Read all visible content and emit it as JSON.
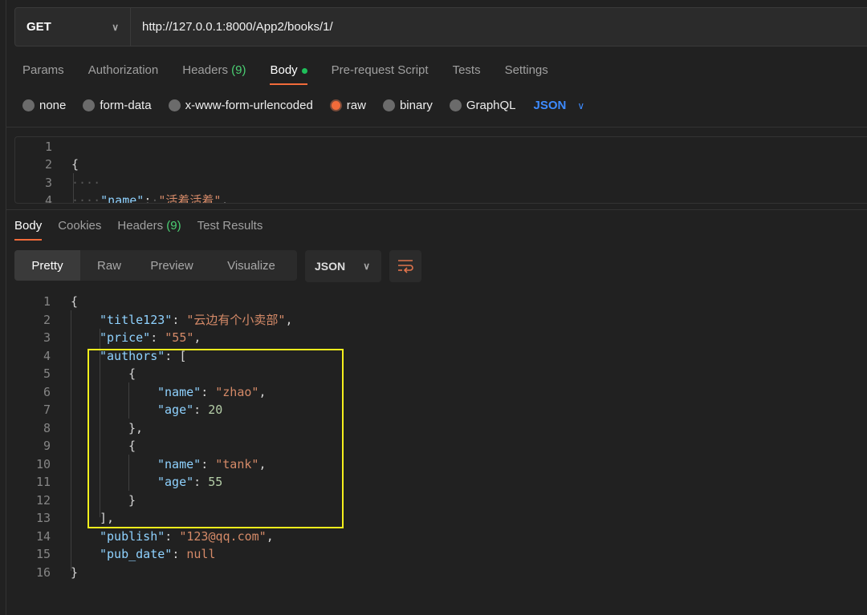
{
  "request": {
    "method": "GET",
    "url": "http://127.0.0.1:8000/App2/books/1/"
  },
  "request_tabs": [
    {
      "label": "Params"
    },
    {
      "label": "Authorization"
    },
    {
      "label": "Headers",
      "count": "(9)"
    },
    {
      "label": "Body",
      "active": true
    },
    {
      "label": "Pre-request Script"
    },
    {
      "label": "Tests"
    },
    {
      "label": "Settings"
    }
  ],
  "body_types": [
    {
      "label": "none"
    },
    {
      "label": "form-data"
    },
    {
      "label": "x-www-form-urlencoded"
    },
    {
      "label": "raw",
      "selected": true
    },
    {
      "label": "binary"
    },
    {
      "label": "GraphQL"
    }
  ],
  "body_format": "JSON",
  "request_body": [
    {
      "num": "1",
      "tokens": []
    },
    {
      "num": "2",
      "tokens": [
        {
          "c": "p",
          "t": "{"
        }
      ]
    },
    {
      "num": "3",
      "tokens": [
        {
          "c": "ws",
          "t": "····"
        }
      ]
    },
    {
      "num": "4",
      "tokens": [
        {
          "c": "ws",
          "t": "····"
        },
        {
          "c": "k",
          "t": "\"name\""
        },
        {
          "c": "p",
          "t": ":"
        },
        {
          "c": "ws",
          "t": "·"
        },
        {
          "c": "s",
          "t": "\"活着活着\""
        },
        {
          "c": "p",
          "t": ","
        }
      ]
    }
  ],
  "response_tabs": [
    {
      "label": "Body",
      "active": true
    },
    {
      "label": "Cookies"
    },
    {
      "label": "Headers",
      "count": "(9)"
    },
    {
      "label": "Test Results"
    }
  ],
  "view_modes": [
    "Pretty",
    "Raw",
    "Preview",
    "Visualize"
  ],
  "response_format": "JSON",
  "colors": {
    "accent": "#f26b3a",
    "json_key": "#8fd2ff",
    "json_string": "#d58a68",
    "json_number": "#b5cea8",
    "highlight_box": "#f5f01c"
  },
  "response_body": [
    {
      "num": "1",
      "indent": 0,
      "tokens": [
        {
          "c": "p",
          "t": "{"
        }
      ]
    },
    {
      "num": "2",
      "indent": 1,
      "tokens": [
        {
          "c": "k",
          "t": "\"title123\""
        },
        {
          "c": "p",
          "t": ": "
        },
        {
          "c": "s",
          "t": "\"云边有个小卖部\""
        },
        {
          "c": "p",
          "t": ","
        }
      ]
    },
    {
      "num": "3",
      "indent": 1,
      "tokens": [
        {
          "c": "k",
          "t": "\"price\""
        },
        {
          "c": "p",
          "t": ": "
        },
        {
          "c": "s",
          "t": "\"55\""
        },
        {
          "c": "p",
          "t": ","
        }
      ]
    },
    {
      "num": "4",
      "indent": 1,
      "tokens": [
        {
          "c": "k",
          "t": "\"authors\""
        },
        {
          "c": "p",
          "t": ": ["
        }
      ]
    },
    {
      "num": "5",
      "indent": 2,
      "tokens": [
        {
          "c": "p",
          "t": "{"
        }
      ]
    },
    {
      "num": "6",
      "indent": 3,
      "tokens": [
        {
          "c": "k",
          "t": "\"name\""
        },
        {
          "c": "p",
          "t": ": "
        },
        {
          "c": "s",
          "t": "\"zhao\""
        },
        {
          "c": "p",
          "t": ","
        }
      ]
    },
    {
      "num": "7",
      "indent": 3,
      "tokens": [
        {
          "c": "k",
          "t": "\"age\""
        },
        {
          "c": "p",
          "t": ": "
        },
        {
          "c": "n",
          "t": "20"
        }
      ]
    },
    {
      "num": "8",
      "indent": 2,
      "tokens": [
        {
          "c": "p",
          "t": "},"
        }
      ]
    },
    {
      "num": "9",
      "indent": 2,
      "tokens": [
        {
          "c": "p",
          "t": "{"
        }
      ]
    },
    {
      "num": "10",
      "indent": 3,
      "tokens": [
        {
          "c": "k",
          "t": "\"name\""
        },
        {
          "c": "p",
          "t": ": "
        },
        {
          "c": "s",
          "t": "\"tank\""
        },
        {
          "c": "p",
          "t": ","
        }
      ]
    },
    {
      "num": "11",
      "indent": 3,
      "tokens": [
        {
          "c": "k",
          "t": "\"age\""
        },
        {
          "c": "p",
          "t": ": "
        },
        {
          "c": "n",
          "t": "55"
        }
      ]
    },
    {
      "num": "12",
      "indent": 2,
      "tokens": [
        {
          "c": "p",
          "t": "}"
        }
      ]
    },
    {
      "num": "13",
      "indent": 1,
      "tokens": [
        {
          "c": "p",
          "t": "],"
        }
      ]
    },
    {
      "num": "14",
      "indent": 1,
      "tokens": [
        {
          "c": "k",
          "t": "\"publish\""
        },
        {
          "c": "p",
          "t": ": "
        },
        {
          "c": "s",
          "t": "\"123@qq.com\""
        },
        {
          "c": "p",
          "t": ","
        }
      ]
    },
    {
      "num": "15",
      "indent": 1,
      "tokens": [
        {
          "c": "k",
          "t": "\"pub_date\""
        },
        {
          "c": "p",
          "t": ": "
        },
        {
          "c": "s",
          "t": "null"
        }
      ]
    },
    {
      "num": "16",
      "indent": 0,
      "tokens": [
        {
          "c": "p",
          "t": "}"
        }
      ]
    }
  ]
}
